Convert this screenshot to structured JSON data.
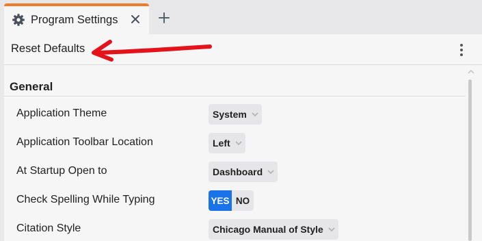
{
  "tab": {
    "title": "Program Settings",
    "icon": "gear-icon",
    "close_icon": "close-icon",
    "accent_color": "#ef7b2a"
  },
  "new_tab": {
    "icon": "plus-icon"
  },
  "toolbar": {
    "reset_label": "Reset Defaults",
    "more_icon": "kebab-menu-icon",
    "annotation_color": "#e3121b"
  },
  "section": {
    "title": "General"
  },
  "settings": [
    {
      "label": "Application Theme",
      "value": "System"
    },
    {
      "label": "Application Toolbar Location",
      "value": "Left"
    },
    {
      "label": "At Startup Open to",
      "value": "Dashboard"
    },
    {
      "label": "Check Spelling While Typing",
      "yes": "YES",
      "no": "NO",
      "selected": "YES"
    },
    {
      "label": "Citation Style",
      "value": "Chicago Manual of Style"
    }
  ],
  "colors": {
    "toggle_active": "#1a73e8"
  }
}
